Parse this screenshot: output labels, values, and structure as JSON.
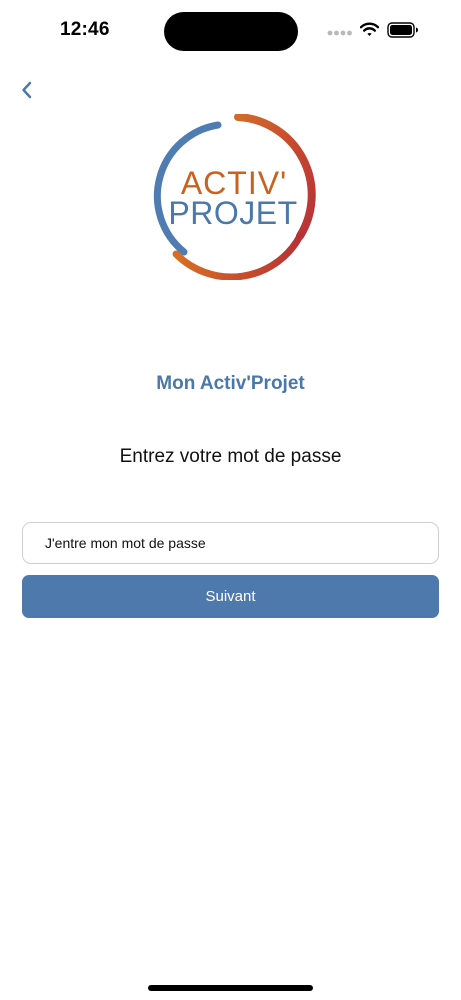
{
  "status_bar": {
    "time": "12:46",
    "icons": [
      "signal-dots-icon",
      "wifi-icon",
      "battery-icon"
    ]
  },
  "navigation": {
    "back_icon": "chevron-left-icon"
  },
  "logo": {
    "line1": "ACTIV'",
    "line2": "PROJET",
    "colors": {
      "orange": "#c9621e",
      "blue": "#4a78ab",
      "red": "#c0393a"
    }
  },
  "main": {
    "title": "Mon Activ'Projet",
    "subtitle": "Entrez votre mot de passe",
    "password": {
      "value": "",
      "placeholder": "J'entre mon mot de passe"
    },
    "next_button_label": "Suivant"
  },
  "theme": {
    "accent": "#4e79ad",
    "text": "#111111",
    "field_border": "#cfcfcf"
  }
}
